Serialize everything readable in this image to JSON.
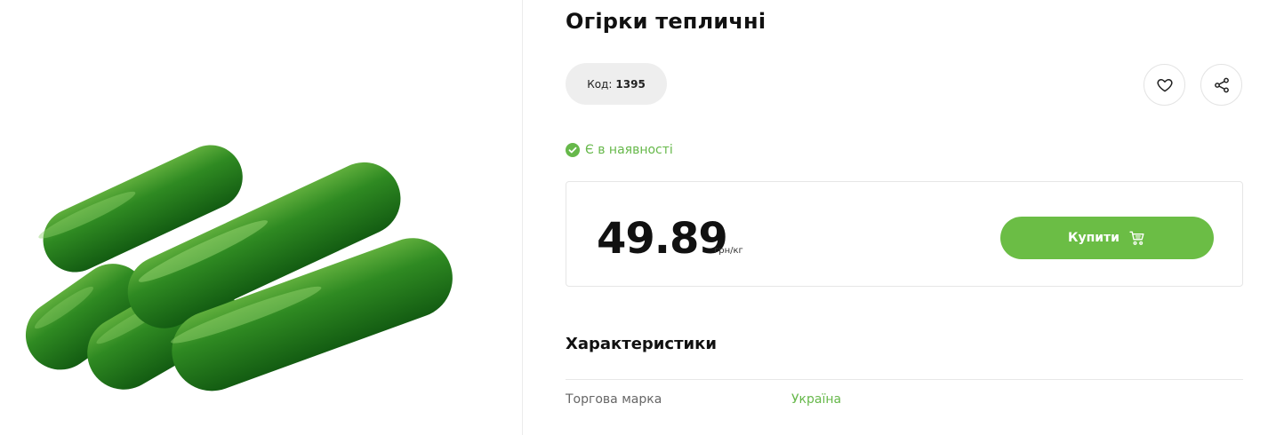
{
  "product": {
    "title": "Огірки тепличні",
    "code_label": "Код:",
    "code_value": "1395",
    "image_name": "cucumber-image"
  },
  "availability": {
    "text": "Є в наявності",
    "color": "#66b84a"
  },
  "price": {
    "value": "49.89",
    "unit": "грн/кг"
  },
  "actions": {
    "buy_label": "Купити",
    "favorite_icon": "heart-icon",
    "share_icon": "share-icon",
    "cart_icon": "cart-icon"
  },
  "characteristics": {
    "title": "Характеристики",
    "rows": [
      {
        "name": "Торгова марка",
        "value": "Україна"
      }
    ]
  },
  "colors": {
    "accent": "#6bbd45",
    "text": "#111111",
    "muted": "#666666",
    "pill_bg": "#eeeeee"
  }
}
